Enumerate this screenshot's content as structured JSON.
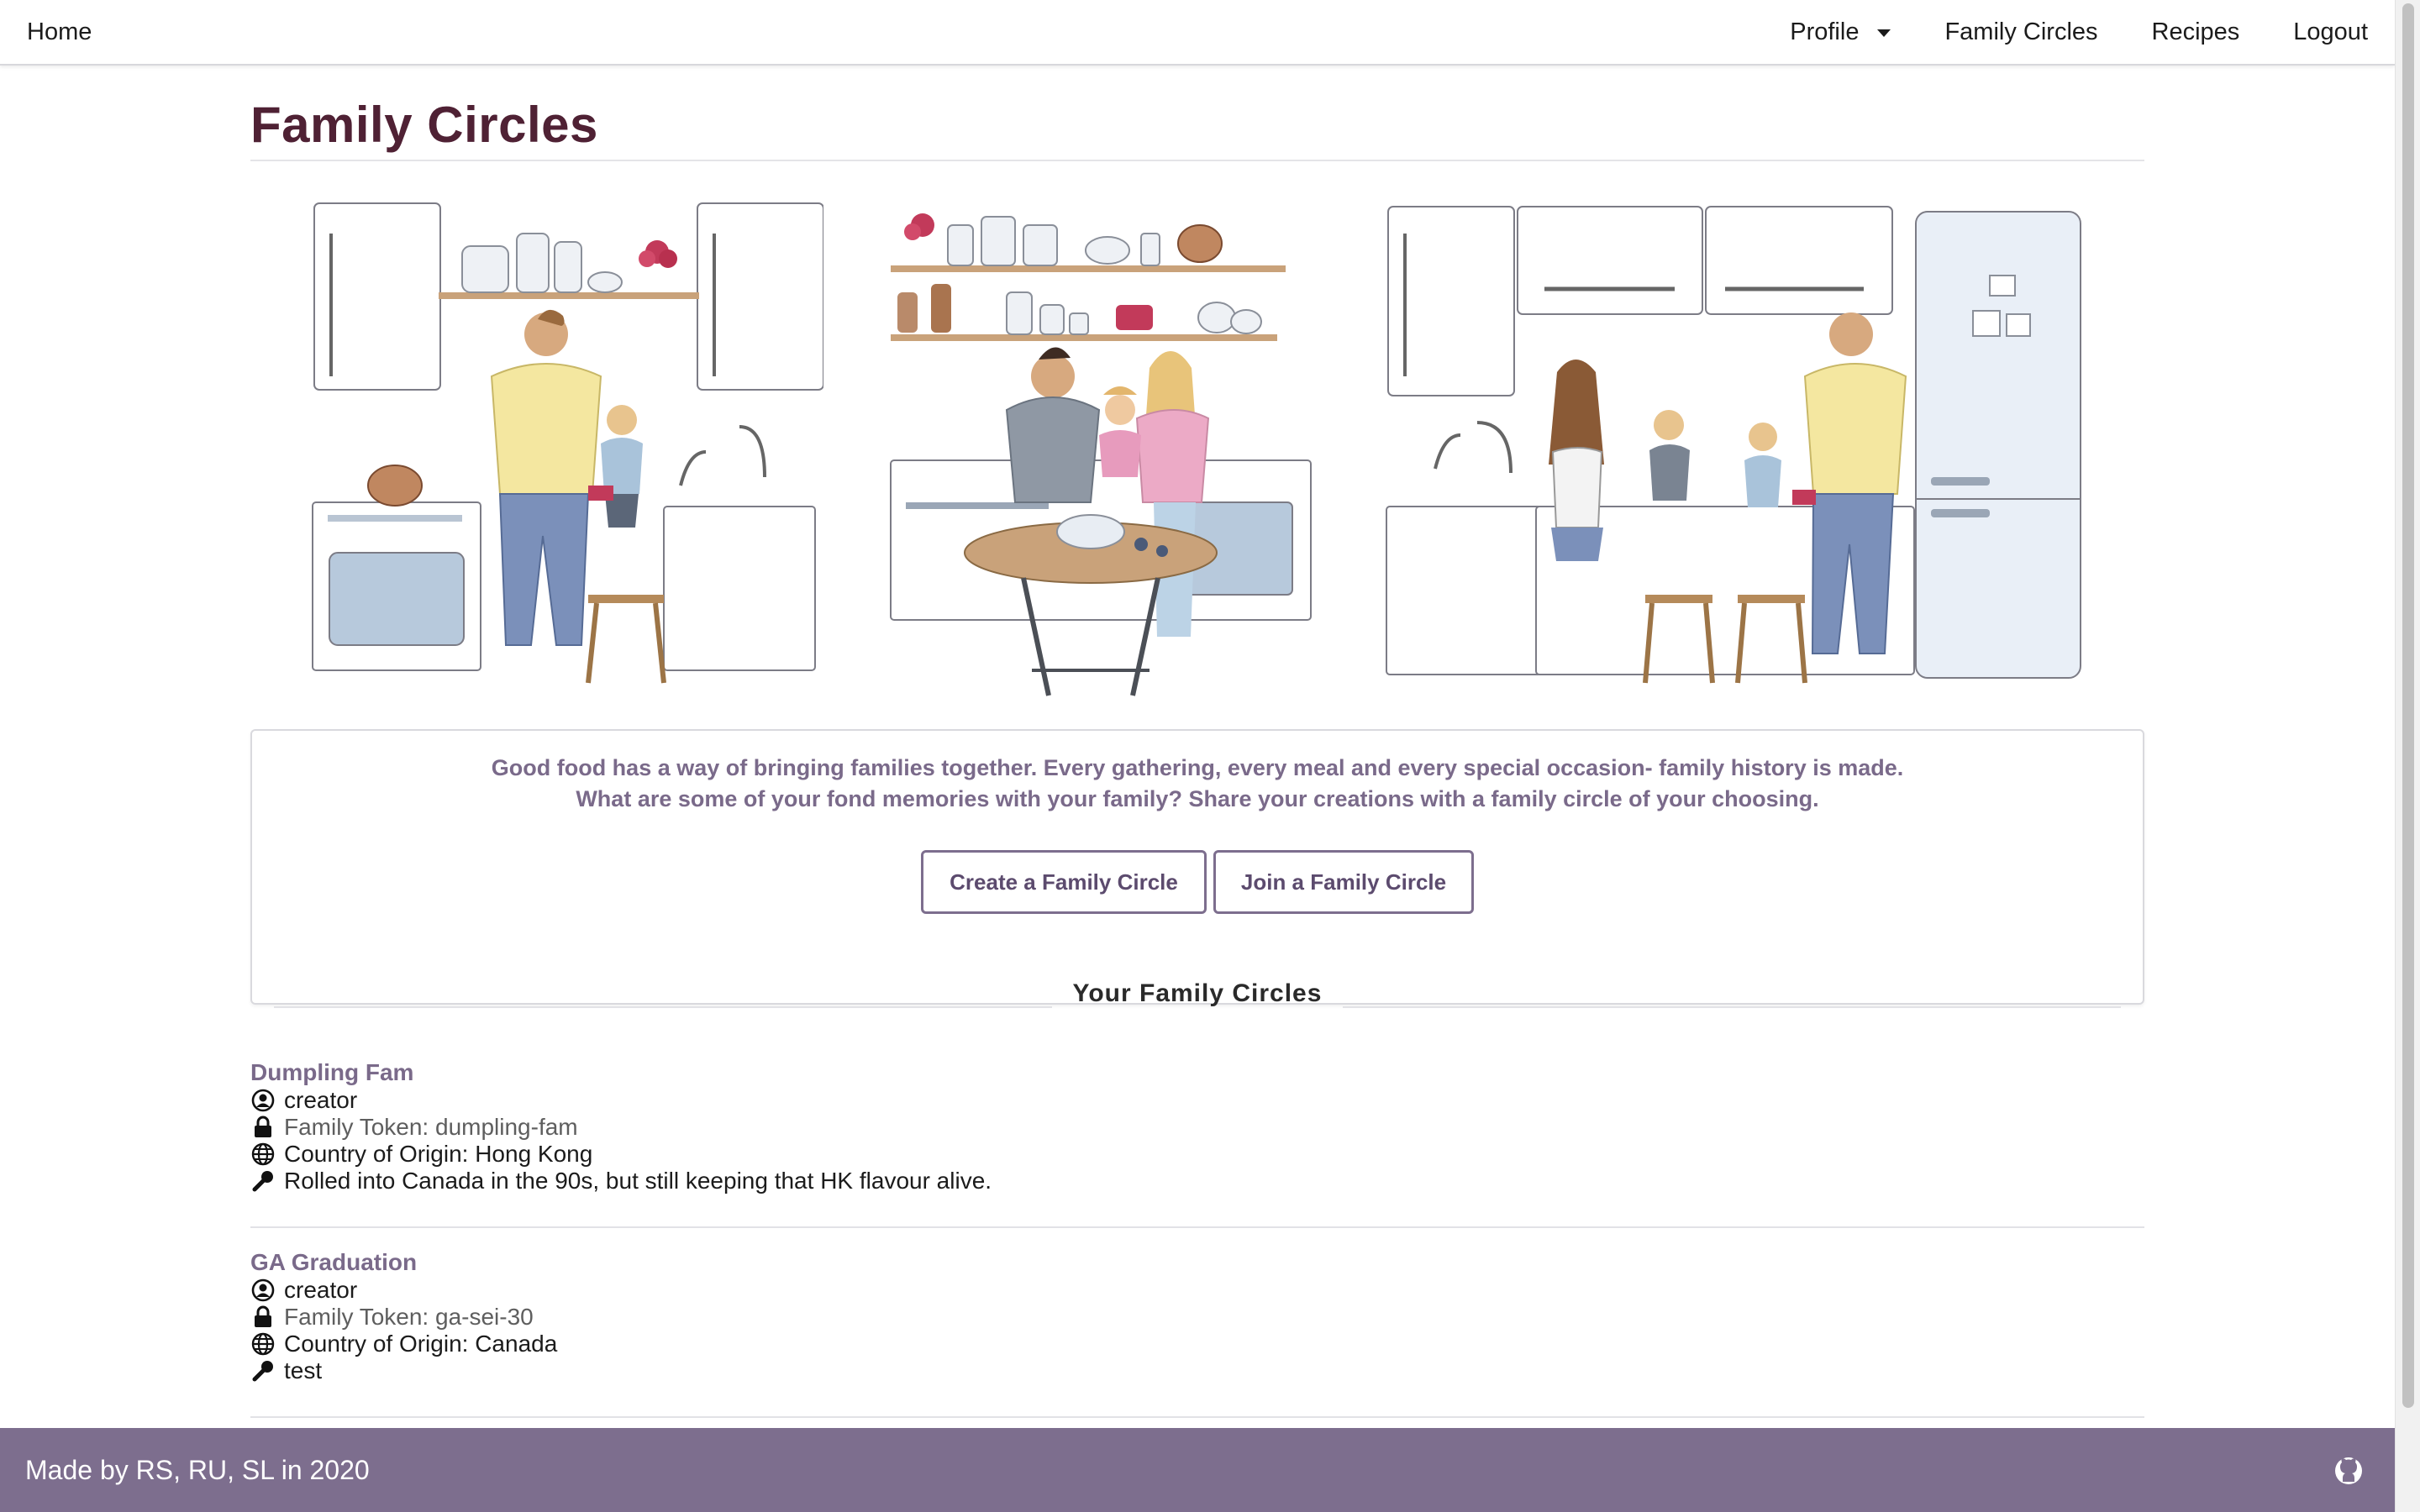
{
  "nav": {
    "home": "Home",
    "profile": "Profile",
    "family_circles": "Family Circles",
    "recipes": "Recipes",
    "logout": "Logout"
  },
  "page": {
    "title": "Family Circles"
  },
  "intro": {
    "line1": "Good food has a way of bringing families together. Every gathering, every meal and every special occasion- family history is made.",
    "line2": "What are some of your fond memories with your family? Share your creations with a family circle of your choosing.",
    "create_button": "Create a Family Circle",
    "join_button": "Join a Family Circle"
  },
  "section": {
    "title": "Your Family Circles"
  },
  "circles": [
    {
      "name": "Dumpling Fam",
      "role": "creator",
      "token": "Family Token: dumpling-fam",
      "country": "Country of Origin: Hong Kong",
      "description": "Rolled into Canada in the 90s, but still keeping that HK flavour alive."
    },
    {
      "name": "GA Graduation",
      "role": "creator",
      "token": "Family Token: ga-sei-30",
      "country": "Country of Origin: Canada",
      "description": "test"
    }
  ],
  "footer": {
    "text": "Made by RS, RU, SL in 2020"
  },
  "icons": {
    "role": "user-circle-icon",
    "token": "lock-icon",
    "country": "globe-icon",
    "description": "wrench-icon",
    "footer": "github-icon"
  },
  "colors": {
    "title": "#4f2134",
    "accent": "#7d6e8e",
    "link": "#7a6a8a"
  }
}
